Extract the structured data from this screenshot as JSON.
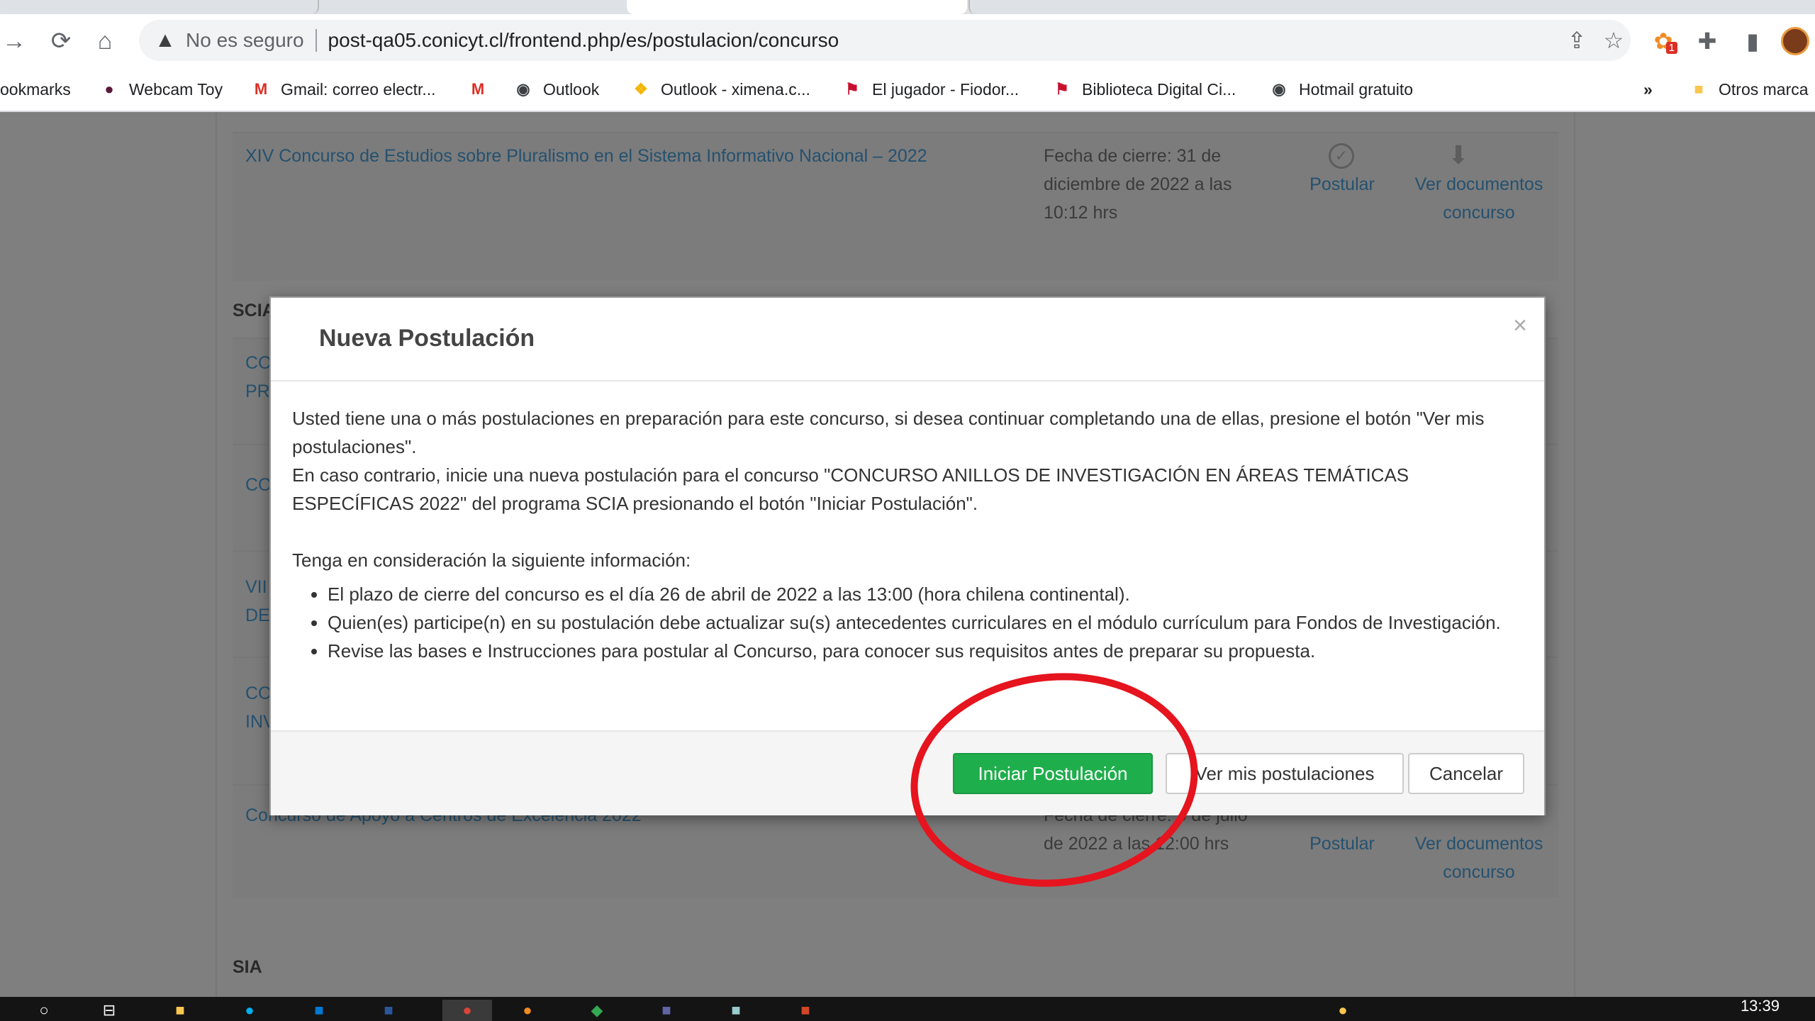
{
  "browser": {
    "security_label": "No es seguro",
    "url": "post-qa05.conicyt.cl/frontend.php/es/postulacion/concurso",
    "bookmarks": [
      {
        "label": "ookmarks",
        "icon": "folder-icon"
      },
      {
        "label": "Webcam Toy",
        "icon": "webcam-icon"
      },
      {
        "label": "Gmail: correo electr...",
        "icon": "gmail-icon"
      },
      {
        "label": "",
        "icon": "gmail-icon"
      },
      {
        "label": "Outlook",
        "icon": "globe-icon"
      },
      {
        "label": "Outlook - ximena.c...",
        "icon": "windows-icon"
      },
      {
        "label": "El jugador - Fiodor...",
        "icon": "flag-icon"
      },
      {
        "label": "Biblioteca Digital Ci...",
        "icon": "flag-icon"
      },
      {
        "label": "Hotmail gratuito",
        "icon": "globe-icon"
      }
    ],
    "more_bookmarks": "»",
    "other_bookmarks": "Otros marca",
    "extension_badge": "1"
  },
  "page": {
    "contests": [
      {
        "title": "XIV Concurso de Estudios sobre Pluralismo en el Sistema Informativo Nacional – 2022",
        "deadline": "Fecha de cierre: 31 de diciembre de 2022 a las 10:12 hrs",
        "apply": "Postular",
        "docs": "Ver documentos concurso"
      },
      {
        "title": "CO PR"
      },
      {
        "title": "CO"
      },
      {
        "title": "VII DE"
      },
      {
        "title": "CO INV"
      },
      {
        "title": "Concurso de Apoyo a Centros de Excelencia 2022",
        "deadline": "Fecha de cierre: 6 de julio de 2022 a las 12:00 hrs",
        "apply": "Postular",
        "docs": "Ver documentos concurso"
      }
    ],
    "sections": {
      "scia": "SCIA",
      "sia": "SIA"
    }
  },
  "modal": {
    "title": "Nueva Postulación",
    "close": "×",
    "p1": "Usted tiene una o más postulaciones en preparación para este concurso, si desea continuar completando una de ellas, presione el botón \"Ver mis postulaciones\".",
    "p2": "En caso contrario, inicie una nueva postulación para el concurso \"CONCURSO ANILLOS DE INVESTIGACIÓN EN ÁREAS TEMÁTICAS ESPECÍFICAS 2022\" del programa SCIA presionando el botón \"Iniciar Postulación\".",
    "info_heading": "Tenga en consideración la siguiente información:",
    "info": [
      "El plazo de cierre del concurso es el día 26 de abril de 2022 a las 13:00 (hora chilena continental).",
      "Quien(es) participe(n) en su postulación debe actualizar su(s) antecedentes curriculares en el módulo currículum para Fondos de Investigación.",
      "Revise las bases e Instrucciones para postular al Concurso, para conocer sus requisitos antes de preparar su propuesta."
    ],
    "buttons": {
      "start": "Iniciar Postulación",
      "mine": "Ver mis postulaciones",
      "cancel": "Cancelar"
    }
  },
  "taskbar": {
    "time": "13:39"
  },
  "colors": {
    "accent_green": "#1fae4c",
    "annotation_red": "#e5141e",
    "link_blue": "#4aa3df"
  }
}
